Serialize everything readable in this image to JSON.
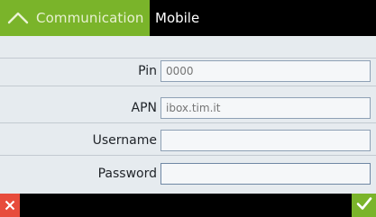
{
  "header": {
    "back_label": "Communication",
    "title": "Mobile"
  },
  "form": {
    "fields": [
      {
        "label": "Pin",
        "value": "",
        "placeholder": "0000"
      },
      {
        "label": "APN",
        "value": "",
        "placeholder": "ibox.tim.it"
      },
      {
        "label": "Username",
        "value": "",
        "placeholder": ""
      },
      {
        "label": "Password",
        "value": "",
        "placeholder": ""
      }
    ]
  },
  "footer": {
    "cancel_icon": "close-icon",
    "confirm_icon": "check-icon"
  },
  "colors": {
    "accent_green": "#7ab42a",
    "cancel_red": "#e74c3c"
  }
}
